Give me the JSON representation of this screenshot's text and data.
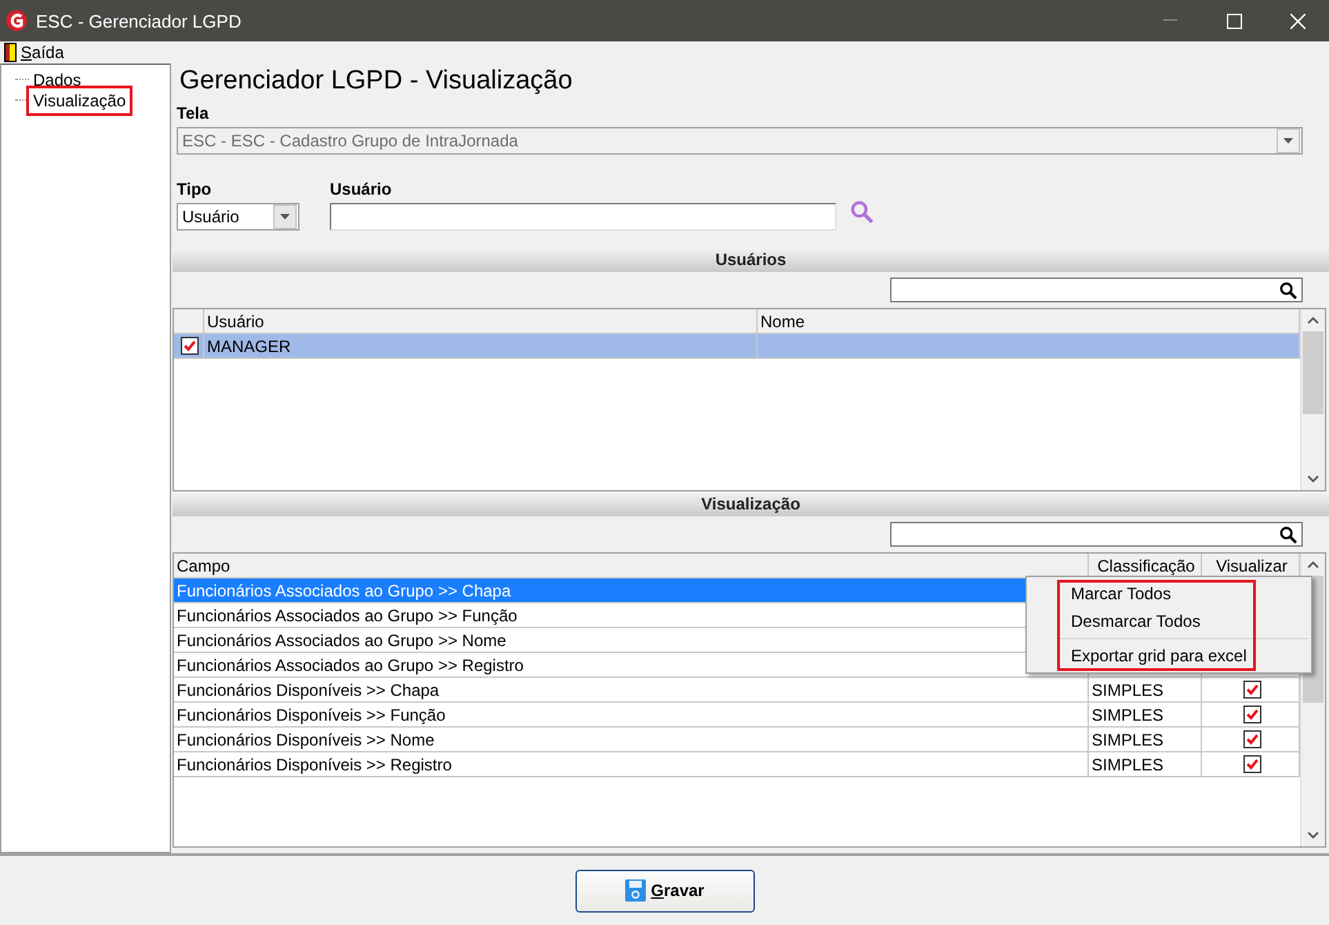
{
  "window": {
    "title": "ESC - Gerenciador LGPD"
  },
  "menu": [
    {
      "label": "Saída"
    }
  ],
  "tree": [
    {
      "label": "Dados",
      "highlighted": false
    },
    {
      "label": "Visualização",
      "highlighted": true
    }
  ],
  "heading": "Gerenciador LGPD - Visualização",
  "tela": {
    "label": "Tela",
    "value": "ESC - ESC - Cadastro Grupo de IntraJornada",
    "disabled": true
  },
  "tipo": {
    "label": "Tipo",
    "value": "Usuário"
  },
  "usuario": {
    "label": "Usuário"
  },
  "users_section": {
    "title": "Usuários",
    "columns": [
      "Usuário",
      "Nome"
    ],
    "rows": [
      {
        "usuario": "MANAGER",
        "checked": true,
        "selected": true
      }
    ]
  },
  "view_section": {
    "title": "Visualização",
    "columns": [
      "Campo",
      "Classificação",
      "Visualizar"
    ],
    "rows": [
      {
        "campo": "Funcionários Associados ao Grupo >> Chapa",
        "selected": true
      },
      {
        "campo": "Funcionários Associados ao Grupo >> Função",
        "selected": false
      },
      {
        "campo": "Funcionários Associados ao Grupo >> Nome",
        "selected": false
      },
      {
        "campo": "Funcionários Associados ao Grupo >> Registro",
        "selected": false
      },
      {
        "campo": "Funcionários Disponíveis >> Chapa",
        "classificacao": "SIMPLES",
        "checked": true,
        "selected": false
      },
      {
        "campo": "Funcionários Disponíveis >> Função",
        "classificacao": "SIMPLES",
        "checked": true,
        "selected": false
      },
      {
        "campo": "Funcionários Disponíveis >> Nome",
        "classificacao": "SIMPLES",
        "checked": true,
        "selected": false
      },
      {
        "campo": "Funcionários Disponíveis >> Registro",
        "classificacao": "SIMPLES",
        "checked": true,
        "selected": false
      }
    ]
  },
  "context_menu": {
    "highlighted": true,
    "items": [
      {
        "kind": "item",
        "label": "Marcar Todos"
      },
      {
        "kind": "item",
        "label": "Desmarcar Todos"
      },
      {
        "kind": "separator"
      },
      {
        "kind": "item",
        "label": "Exportar grid para excel"
      }
    ]
  },
  "save_button": {
    "label": "Gravar"
  }
}
